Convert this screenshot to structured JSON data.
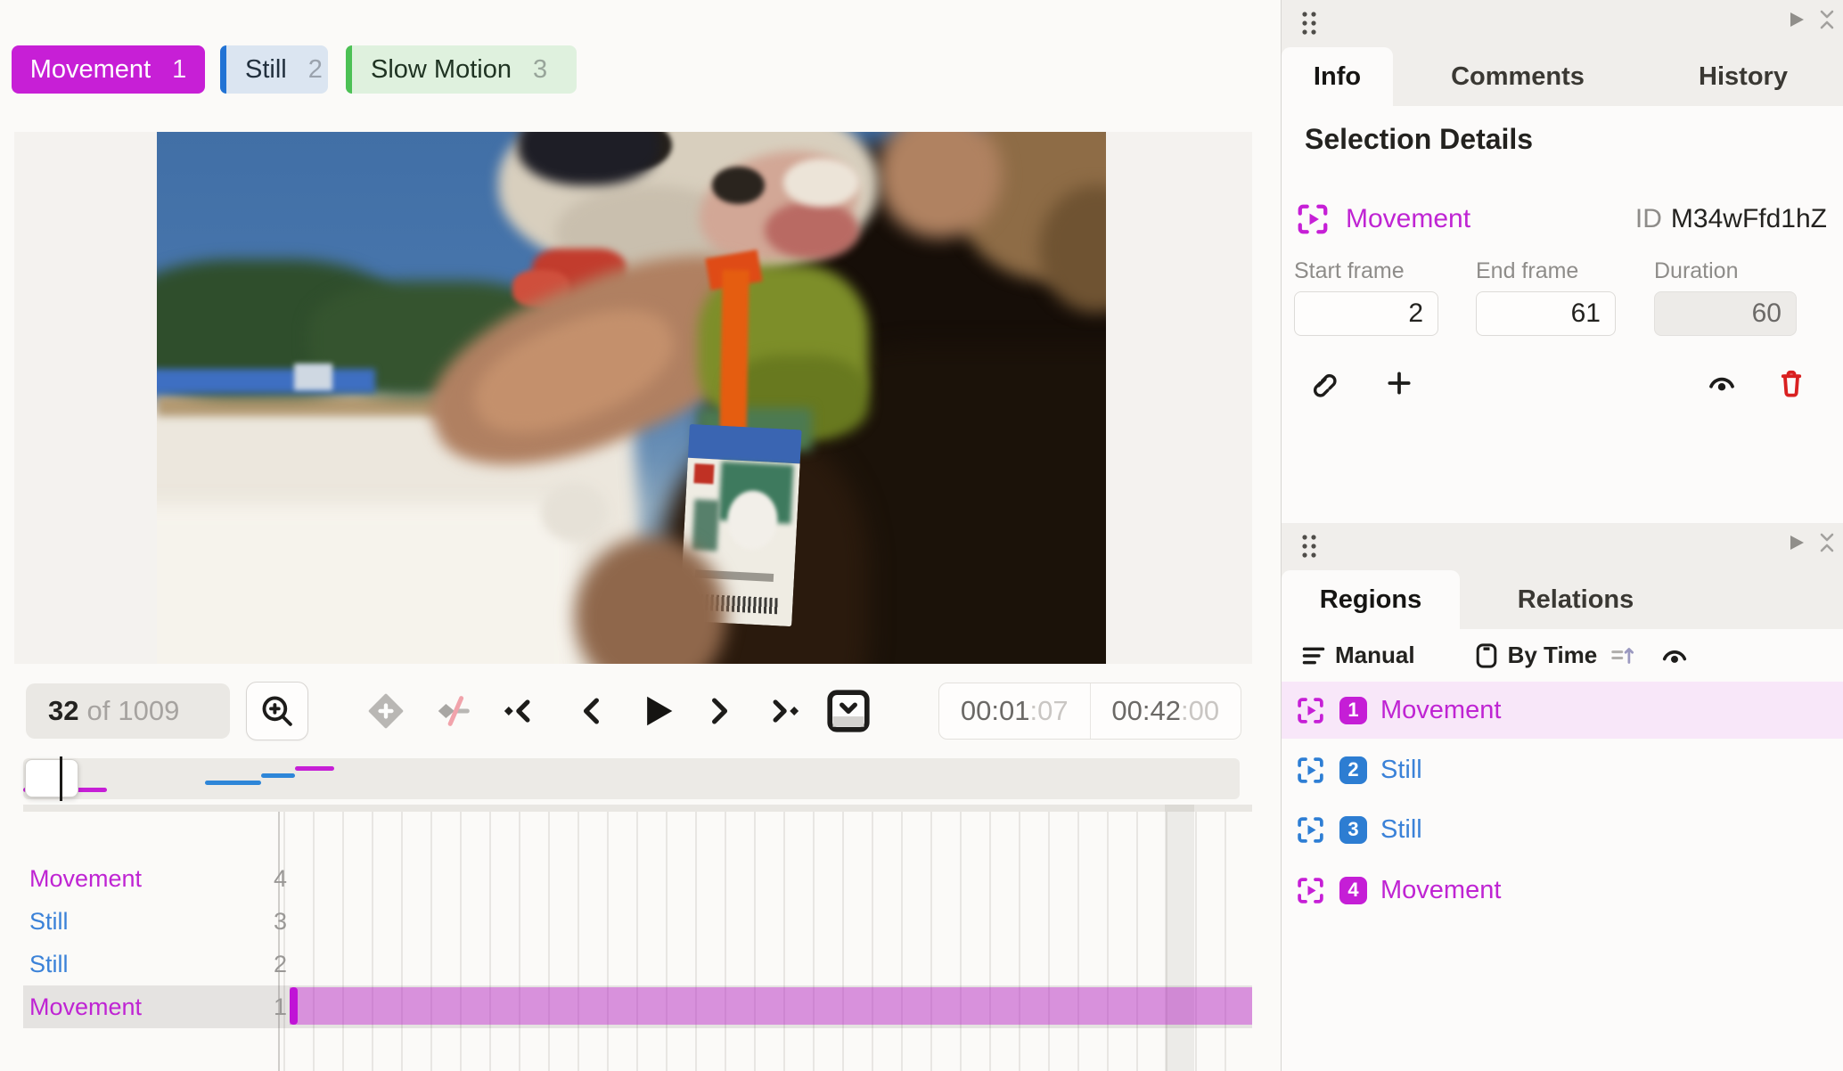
{
  "colors": {
    "magenta": "#c61fd6",
    "blue": "#2e7ed4",
    "green": "#4cc155",
    "selected_region_bg": "#f8e7f9",
    "danger_red": "#d92020"
  },
  "label_toolbar": {
    "labels": [
      {
        "text": "Movement",
        "hotkey": "1"
      },
      {
        "text": "Still",
        "hotkey": "2"
      },
      {
        "text": "Slow Motion",
        "hotkey": "3"
      }
    ]
  },
  "player": {
    "frame_counter": {
      "current": "32",
      "separator": "of",
      "total": "1009"
    },
    "time_current_main": "00:01",
    "time_current_sub": ":07",
    "time_total_main": "00:42",
    "time_total_sub": ":00"
  },
  "timeline": {
    "tracks": [
      {
        "label": "Movement",
        "num": "4"
      },
      {
        "label": "Still",
        "num": "3"
      },
      {
        "label": "Still",
        "num": "2"
      },
      {
        "label": "Movement",
        "num": "1"
      }
    ]
  },
  "info_panel": {
    "tabs": {
      "info": "Info",
      "comments": "Comments",
      "history": "History"
    },
    "heading": "Selection Details",
    "region_label": "Movement",
    "id_label": "ID",
    "id_value": "M34wFfd1hZ",
    "fields": {
      "start": {
        "label": "Start frame",
        "value": "2"
      },
      "end": {
        "label": "End frame",
        "value": "61"
      },
      "duration": {
        "label": "Duration",
        "value": "60"
      }
    }
  },
  "regions_panel": {
    "tabs": {
      "regions": "Regions",
      "relations": "Relations"
    },
    "toolbar": {
      "manual": "Manual",
      "by_time": "By Time"
    },
    "items": [
      {
        "num": "1",
        "label": "Movement"
      },
      {
        "num": "2",
        "label": "Still"
      },
      {
        "num": "3",
        "label": "Still"
      },
      {
        "num": "4",
        "label": "Movement"
      }
    ]
  }
}
